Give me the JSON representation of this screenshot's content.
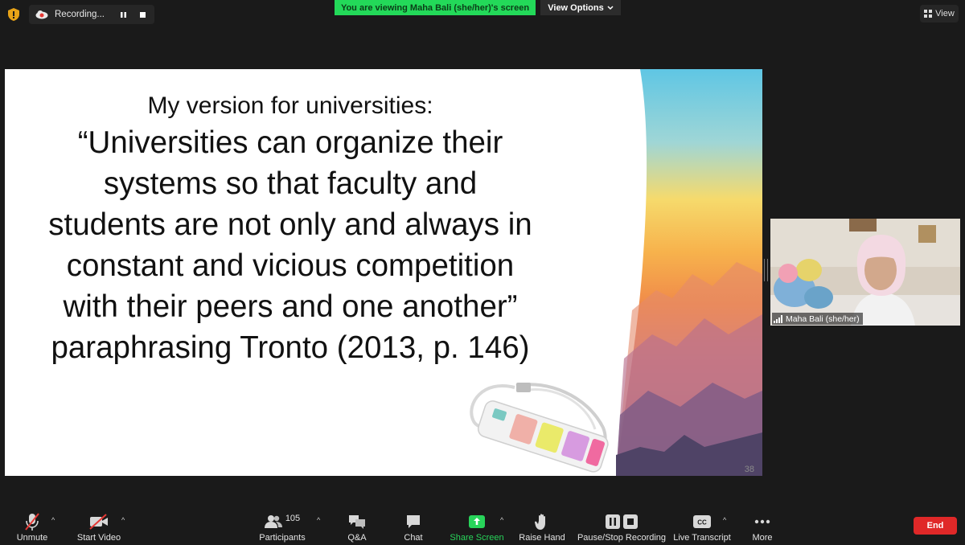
{
  "recording": {
    "label": "Recording..."
  },
  "banner": {
    "text": "You are viewing Maha Bali (she/her)'s screen"
  },
  "view_options": {
    "label": "View Options"
  },
  "view_button": {
    "label": "View"
  },
  "slide": {
    "subtitle": "My version for universities:",
    "quote_lines": [
      "“Universities can organize their",
      "systems so that faculty and",
      "students are not only and always in",
      "constant and vicious competition",
      "with their peers and one another”",
      "paraphrasing Tronto (2013, p. 146)"
    ],
    "page_number": "38"
  },
  "participant": {
    "name": "Maha Bali (she/her)"
  },
  "toolbar": {
    "unmute": "Unmute",
    "start_video": "Start Video",
    "participants": "Participants",
    "participants_count": "105",
    "qa": "Q&A",
    "chat": "Chat",
    "share_screen": "Share Screen",
    "raise_hand": "Raise Hand",
    "pause_stop_recording": "Pause/Stop Recording",
    "live_transcript": "Live Transcript",
    "more": "More",
    "end": "End"
  },
  "colors": {
    "background": "#1a1a1a",
    "banner_green": "#23d959",
    "share_green": "#28d45a",
    "end_red": "#e02828",
    "mute_red": "#e53935"
  },
  "icons": [
    "shield-icon",
    "cloud-record-icon",
    "pause-icon",
    "stop-icon",
    "chevron-down-icon",
    "grid-view-icon",
    "microphone-muted-icon",
    "video-off-icon",
    "participants-icon",
    "qa-icon",
    "chat-icon",
    "share-screen-icon",
    "raise-hand-icon",
    "pause-stop-icon",
    "cc-icon",
    "more-icon",
    "signal-icon"
  ]
}
